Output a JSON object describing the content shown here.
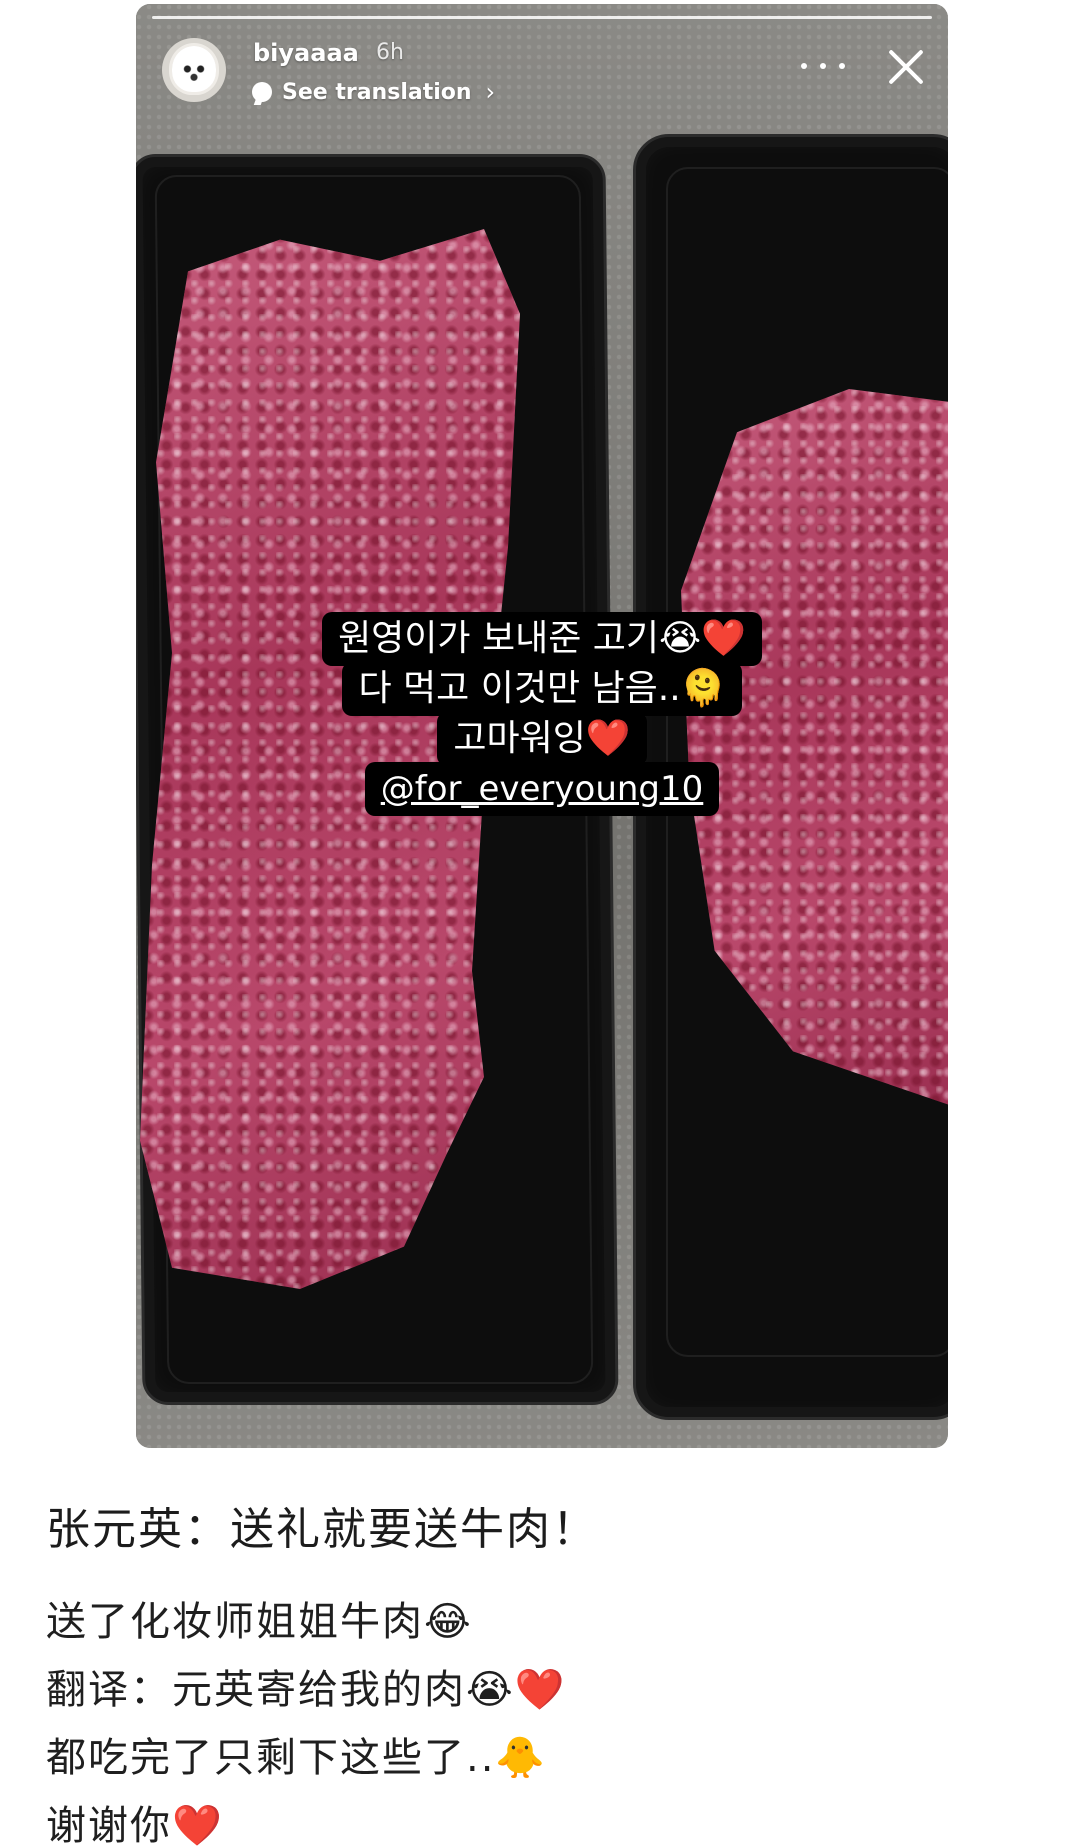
{
  "story": {
    "username": "biyaaaa",
    "time": "6h",
    "see_translation": "See translation",
    "chevron": "›",
    "avatar_icon": "poodle-avatar-icon",
    "more_icon": "more-dots-icon",
    "close_icon": "close-icon",
    "translate_icon": "translate-bubble-icon",
    "stickers": [
      "원영이가 보내준 고기😭❤️",
      "다 먹고 이것만 남음..🫠",
      "고마워잉❤️",
      "@for_everyoung10"
    ]
  },
  "caption": {
    "title": "张元英：送礼就要送牛肉！",
    "lines": [
      "送了化妆师姐姐牛肉😂",
      "翻译：元英寄给我的肉😭❤️",
      "都吃完了只剩下这些了..🐥",
      "谢谢你❤️"
    ]
  }
}
